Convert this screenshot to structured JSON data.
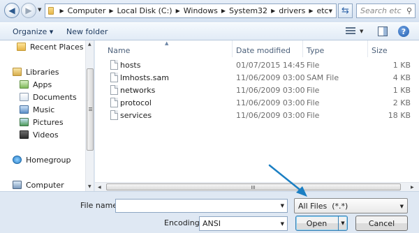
{
  "address": {
    "crumbs": [
      "Computer",
      "Local Disk (C:)",
      "Windows",
      "System32",
      "drivers",
      "etc"
    ],
    "search_placeholder": "Search etc"
  },
  "toolbar": {
    "organize_label": "Organize ▾",
    "new_folder_label": "New folder"
  },
  "nav": {
    "items": [
      {
        "label": "Recent Places",
        "icon": "recent-places-icon"
      },
      {
        "label": "Libraries",
        "icon": "libraries-icon"
      },
      {
        "label": "Apps",
        "icon": "apps-library-icon"
      },
      {
        "label": "Documents",
        "icon": "documents-icon"
      },
      {
        "label": "Music",
        "icon": "music-icon"
      },
      {
        "label": "Pictures",
        "icon": "pictures-icon"
      },
      {
        "label": "Videos",
        "icon": "videos-icon"
      },
      {
        "label": "Homegroup",
        "icon": "homegroup-icon"
      },
      {
        "label": "Computer",
        "icon": "computer-icon"
      }
    ]
  },
  "list": {
    "columns": {
      "name": "Name",
      "date": "Date modified",
      "type": "Type",
      "size": "Size"
    },
    "rows": [
      {
        "name": "hosts",
        "date": "01/07/2015 14:45",
        "type": "File",
        "size": "1 KB"
      },
      {
        "name": "lmhosts.sam",
        "date": "11/06/2009 03:00",
        "type": "SAM File",
        "size": "4 KB"
      },
      {
        "name": "networks",
        "date": "11/06/2009 03:00",
        "type": "File",
        "size": "1 KB"
      },
      {
        "name": "protocol",
        "date": "11/06/2009 03:00",
        "type": "File",
        "size": "2 KB"
      },
      {
        "name": "services",
        "date": "11/06/2009 03:00",
        "type": "File",
        "size": "18 KB"
      }
    ]
  },
  "bottom": {
    "file_name_label": "File name:",
    "file_name_value": "",
    "file_type_value": "All Files  (*.*)",
    "encoding_label": "Encoding:",
    "encoding_value": "ANSI",
    "open_label": "Open",
    "cancel_label": "Cancel"
  },
  "colors": {
    "accent": "#1f7ab8",
    "annotation_arrow": "#1b7fc3"
  }
}
